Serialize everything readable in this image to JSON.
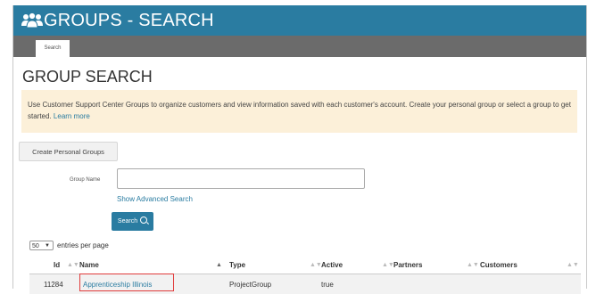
{
  "header": {
    "title": "GROUPS - SEARCH",
    "icon": "users-icon"
  },
  "tabs": [
    {
      "label": "Search"
    }
  ],
  "page_title": "GROUP SEARCH",
  "info": {
    "text": "Use Customer Support Center Groups to organize customers and view information saved with each customer's account. Create your personal group or select a group to get started.",
    "link": "Learn more"
  },
  "create_button": "Create Personal Groups",
  "form": {
    "group_name_label": "Group Name",
    "group_name_value": "",
    "advanced_link": "Show Advanced Search",
    "search_button": "Search"
  },
  "entries": {
    "value": "50",
    "label": "entries per page"
  },
  "table": {
    "columns": [
      "Id",
      "Name",
      "Type",
      "Active",
      "Partners",
      "Customers"
    ],
    "rows": [
      {
        "id": "11284",
        "name": "Apprenticeship Illinois",
        "type": "ProjectGroup",
        "active": "true",
        "partners": "",
        "customers": ""
      }
    ]
  },
  "colors": {
    "header_bg": "#2a7ca1",
    "tabstrip_bg": "#6b6b6b",
    "info_bg": "#fcf0d9",
    "link": "#2a7ca1",
    "highlight": "#e03c3c"
  }
}
